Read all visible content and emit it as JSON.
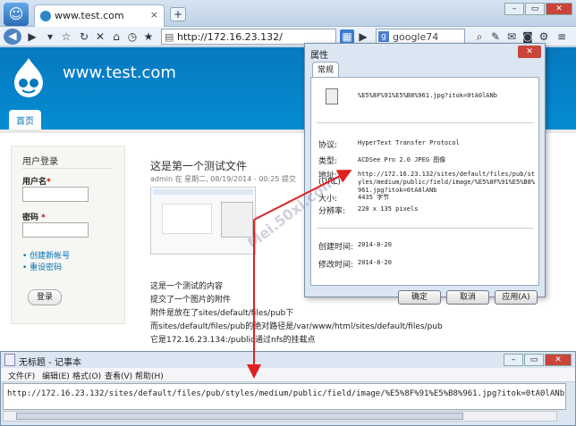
{
  "browser": {
    "tab_title": "www.test.com",
    "tab_close": "×",
    "new_tab": "+",
    "url": "http://172.16.23.132/",
    "search_query": "google74",
    "window_buttons": [
      "–",
      "▭",
      "✕"
    ]
  },
  "site": {
    "name": "www.test.com",
    "nav_home": "首页",
    "login": {
      "heading": "用户登录",
      "username_label": "用户名",
      "password_label": "密码",
      "required": "*",
      "create_account": "创建新帐号",
      "reset_password": "重设密码",
      "login_button": "登录"
    },
    "post": {
      "title": "这是第一个测试文件",
      "meta": "admin 在 星期二, 08/19/2014 - 00:25 提交",
      "body": [
        "这是一个测试的内容",
        "提交了一个图片的附件",
        "附件是放在了sites/default/files/pub下",
        "而sites/default/files/pub的绝对路径是/var/www/html/sites/default/files/pub",
        "它是172.16.23.134:/public通过nfs的挂载点"
      ]
    }
  },
  "properties": {
    "title": "属性",
    "tab": "常规",
    "filename": "%E5%8F%91%E5%B8%961.jpg?itok=0tA0lANb",
    "fields": [
      {
        "key": "协议:",
        "value": "HyperText Transfer Protocol"
      },
      {
        "key": "类型:",
        "value": "ACDSee Pro 2.0 JPEG 图像"
      },
      {
        "key": "地址:",
        "key2": "(URL)",
        "value": "http://172.16.23.132/sites/default/files/pub/st",
        "value2": "yles/medium/public/field/image/%E5%8F%91%E5%B8%",
        "value3": "961.jpg?itok=0tA0lANb"
      },
      {
        "key": "大小:",
        "value": "4435 字节"
      },
      {
        "key": "分辨率:",
        "value": "220 x 135 pixels"
      },
      {
        "key": "创建时间:",
        "value": "2014-8-20"
      },
      {
        "key": "修改时间:",
        "value": "2014-8-20"
      }
    ],
    "ok": "确定",
    "cancel": "取消",
    "apply": "应用(A)"
  },
  "notepad": {
    "title": "无标题 - 记事本",
    "menu": [
      "文件(F)",
      "编辑(E)",
      "格式(O)",
      "查看(V)",
      "帮助(H)"
    ],
    "content": "http://172.16.23.132/sites/default/files/pub/styles/medium/public/field/image/%E5%8F%91%E5%B8%961.jpg?itok=0tA0lANb"
  },
  "watermark": "Mei.50xi.com",
  "colors": {
    "drupal_blue": "#0779bf",
    "arrow_red": "#e02020"
  }
}
